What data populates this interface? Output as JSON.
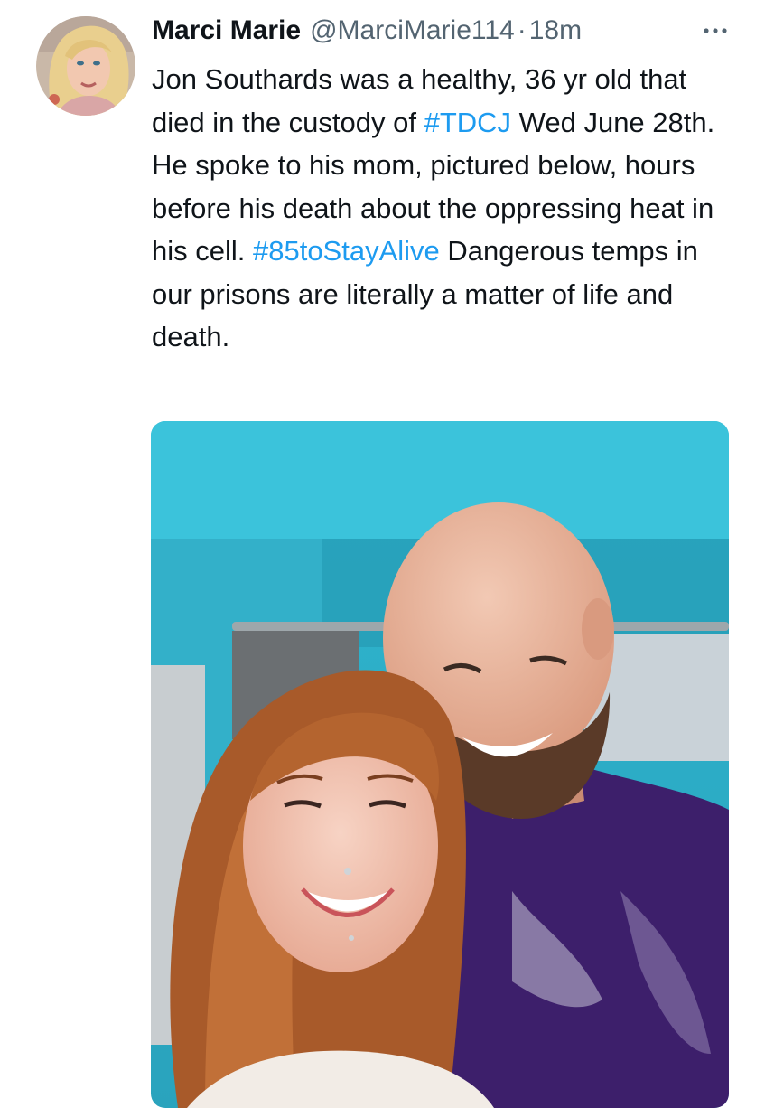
{
  "tweet": {
    "display_name": "Marci Marie",
    "handle": "@MarciMarie114",
    "separator": "·",
    "time": "18m",
    "more_icon": "more-horizontal-icon",
    "text_segments": [
      {
        "text": "Jon Southards was a healthy, 36 yr old that died in the custody of ",
        "link": false
      },
      {
        "text": "#TDCJ",
        "link": true
      },
      {
        "text": " Wed June 28th. He spoke to his mom, pictured below, hours before his death about the oppressing heat in his cell. ",
        "link": false
      },
      {
        "text": "#85toStayAlive",
        "link": true
      },
      {
        "text": " Dangerous temps in our prisons are literally a matter of life and death.",
        "link": false
      }
    ],
    "media": {
      "type": "photo"
    }
  },
  "colors": {
    "text_primary": "#0f1419",
    "text_secondary": "#536471",
    "link": "#1d9bf0",
    "background": "#ffffff"
  }
}
